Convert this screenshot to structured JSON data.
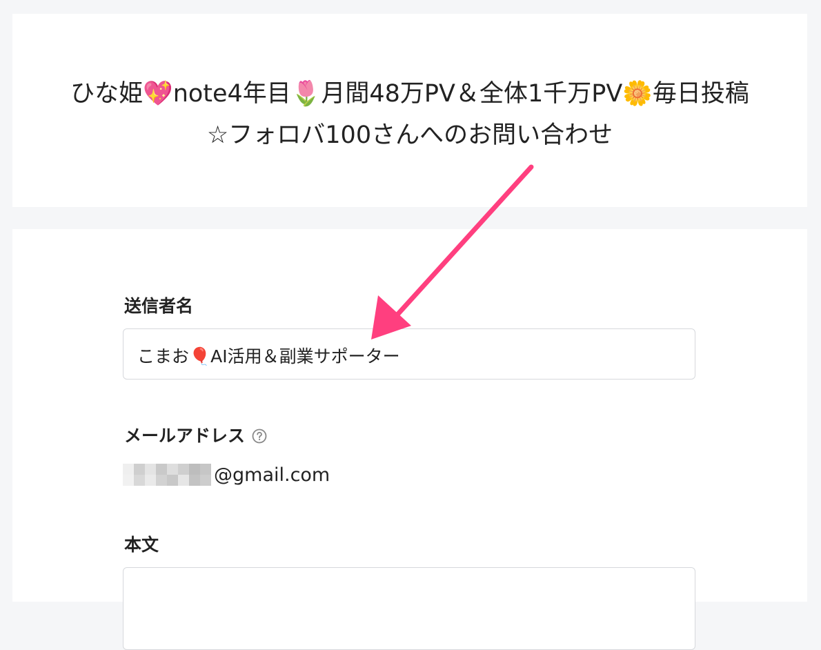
{
  "header": {
    "title_line1": "ひな姫💖note4年目🌷月間48万PV＆全体1千万PV🌼毎日投稿",
    "title_line2": "☆フォロバ100さんへのお問い合わせ"
  },
  "form": {
    "sender_label": "送信者名",
    "sender_value": "こまお🎈AI活用＆副業サポーター",
    "email_label": "メールアドレス",
    "email_suffix": "@gmail.com",
    "body_label": "本文",
    "body_value": ""
  },
  "colors": {
    "accent_arrow": "#ff3f7f",
    "page_bg": "#f5f6f8",
    "card_bg": "#ffffff",
    "input_border": "#d6d8dc"
  },
  "icons": {
    "help": "question-circle-icon"
  }
}
